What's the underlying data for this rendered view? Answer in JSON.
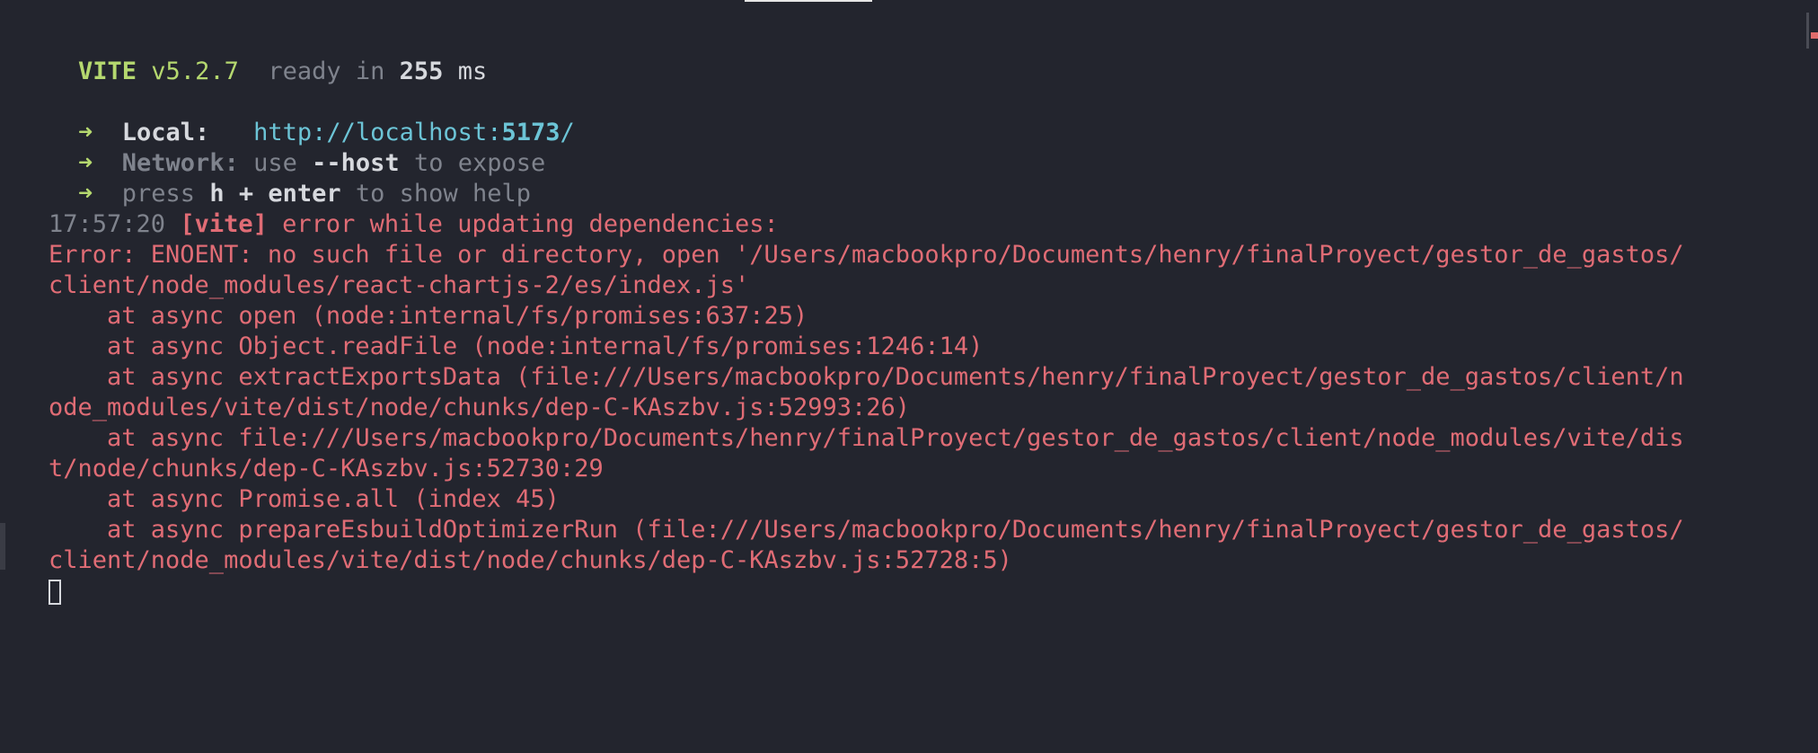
{
  "vite": {
    "name": "VITE",
    "version": "v5.2.7",
    "ready_text": "ready in",
    "ready_ms": "255",
    "ms_label": "ms"
  },
  "server": {
    "arrow": "➜",
    "local_label": "Local:",
    "local_url_prefix": "http://localhost:",
    "local_port": "5173",
    "local_url_suffix": "/",
    "network_label": "Network:",
    "network_use": "use",
    "network_flag": "--host",
    "network_rest": "to expose",
    "press_text": "press",
    "press_keys": "h + enter",
    "press_rest": "to show help"
  },
  "error": {
    "timestamp": "17:57:20",
    "tag": "[vite]",
    "message": "error while updating dependencies:",
    "lines": [
      "Error: ENOENT: no such file or directory, open '/Users/macbookpro/Documents/henry/finalProyect/gestor_de_gastos/",
      "client/node_modules/react-chartjs-2/es/index.js'",
      "    at async open (node:internal/fs/promises:637:25)",
      "    at async Object.readFile (node:internal/fs/promises:1246:14)",
      "    at async extractExportsData (file:///Users/macbookpro/Documents/henry/finalProyect/gestor_de_gastos/client/n",
      "ode_modules/vite/dist/node/chunks/dep-C-KAszbv.js:52993:26)",
      "    at async file:///Users/macbookpro/Documents/henry/finalProyect/gestor_de_gastos/client/node_modules/vite/dis",
      "t/node/chunks/dep-C-KAszbv.js:52730:29",
      "    at async Promise.all (index 45)",
      "    at async prepareEsbuildOptimizerRun (file:///Users/macbookpro/Documents/henry/finalProyect/gestor_de_gastos/",
      "client/node_modules/vite/dist/node/chunks/dep-C-KAszbv.js:52728:5)"
    ]
  },
  "colors": {
    "background": "#23252e",
    "green": "#b5d86f",
    "cyan": "#6cc4d6",
    "red": "#e06c75",
    "gray": "#7f838d"
  }
}
